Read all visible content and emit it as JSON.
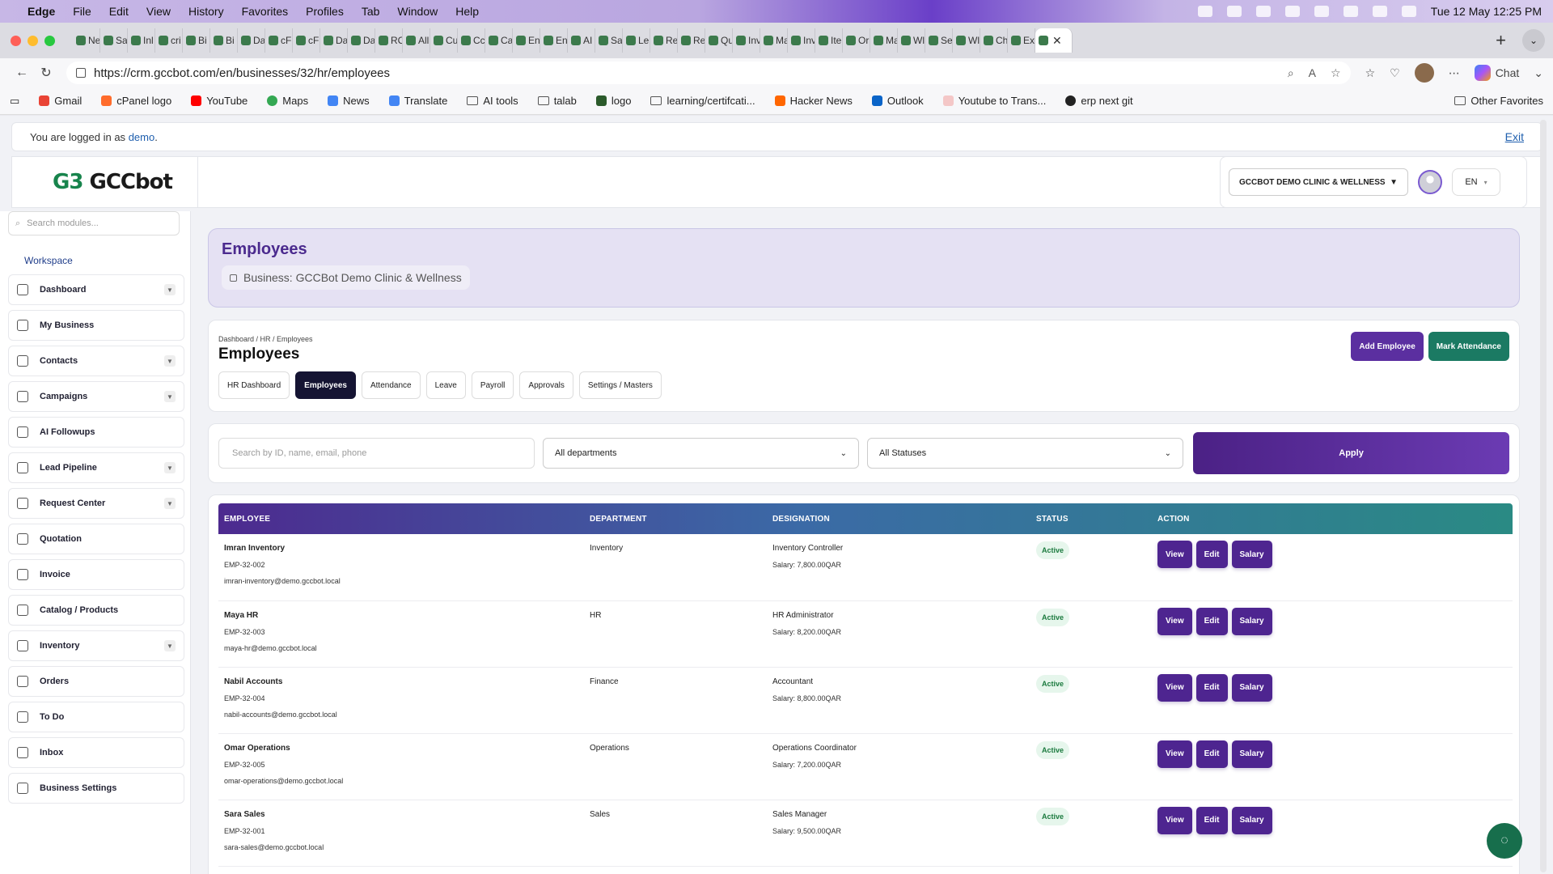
{
  "menubar": {
    "app": "Edge",
    "items": [
      "File",
      "Edit",
      "View",
      "History",
      "Favorites",
      "Profiles",
      "Tab",
      "Window",
      "Help"
    ],
    "clock": "Tue 12 May  12:25 PM"
  },
  "browser": {
    "tabs": [
      "Ne",
      "Sa",
      "Inl",
      "cri",
      "Bi",
      "Bi",
      "Da",
      "cF",
      "cF",
      "Da",
      "Da",
      "RC",
      "All",
      "Cu",
      "Cc",
      "Ca",
      "En",
      "En",
      "AI",
      "Sa",
      "Le",
      "Re",
      "Re",
      "Qu",
      "Inv",
      "Ma",
      "Inv",
      "Ite",
      "Or",
      "Ma",
      "Wl",
      "Se",
      "Wl",
      "Ch",
      "Ex"
    ],
    "url": "https://crm.gccbot.com/en/businesses/32/hr/employees",
    "chat_label": "Chat",
    "bookmarks": [
      "Gmail",
      "cPanel logo",
      "YouTube",
      "Maps",
      "News",
      "Translate",
      "AI tools",
      "talab",
      "logo",
      "learning/certifcati...",
      "Hacker News",
      "Outlook",
      "Youtube to Trans...",
      "erp next git"
    ],
    "other_favorites": "Other Favorites"
  },
  "login": {
    "prefix": "You are logged in as",
    "user": "demo",
    "suffix": ".",
    "exit": "Exit"
  },
  "header": {
    "logo_mark": "G3",
    "logo_text": "GCCbot",
    "business": "GCCBOT DEMO CLINIC & WELLNESS",
    "lang": "EN"
  },
  "sidebar": {
    "search_placeholder": "Search modules...",
    "workspace": "Workspace",
    "items": [
      {
        "label": "Dashboard",
        "caret": true
      },
      {
        "label": "My Business",
        "caret": false
      },
      {
        "label": "Contacts",
        "caret": true
      },
      {
        "label": "Campaigns",
        "caret": true
      },
      {
        "label": "AI Followups",
        "caret": false
      },
      {
        "label": "Lead Pipeline",
        "caret": true
      },
      {
        "label": "Request Center",
        "caret": true
      },
      {
        "label": "Quotation",
        "caret": false
      },
      {
        "label": "Invoice",
        "caret": false
      },
      {
        "label": "Catalog / Products",
        "caret": false
      },
      {
        "label": "Inventory",
        "caret": true
      },
      {
        "label": "Orders",
        "caret": false
      },
      {
        "label": "To Do",
        "caret": false
      },
      {
        "label": "Inbox",
        "caret": false
      },
      {
        "label": "Business Settings",
        "caret": false
      }
    ]
  },
  "hero": {
    "title": "Employees",
    "business_label": "Business: GCCBot Demo Clinic & Wellness"
  },
  "card": {
    "breadcrumb": "Dashboard / HR / Employees",
    "title": "Employees",
    "tabs": [
      "HR Dashboard",
      "Employees",
      "Attendance",
      "Leave",
      "Payroll",
      "Approvals",
      "Settings / Masters"
    ],
    "active_tab": "Employees",
    "add_employee": "Add Employee",
    "mark_attendance": "Mark Attendance"
  },
  "filters": {
    "search_placeholder": "Search by ID, name, email, phone",
    "department": "All departments",
    "status": "All Statuses",
    "apply": "Apply"
  },
  "table": {
    "headers": [
      "EMPLOYEE",
      "DEPARTMENT",
      "DESIGNATION",
      "STATUS",
      "ACTION"
    ],
    "rows": [
      {
        "name": "Imran Inventory",
        "id": "EMP-32-002",
        "email": "imran-inventory@demo.gccbot.local",
        "department": "Inventory",
        "designation": "Inventory Controller",
        "salary": "Salary: 7,800.00QAR",
        "status": "Active"
      },
      {
        "name": "Maya HR",
        "id": "EMP-32-003",
        "email": "maya-hr@demo.gccbot.local",
        "department": "HR",
        "designation": "HR Administrator",
        "salary": "Salary: 8,200.00QAR",
        "status": "Active"
      },
      {
        "name": "Nabil Accounts",
        "id": "EMP-32-004",
        "email": "nabil-accounts@demo.gccbot.local",
        "department": "Finance",
        "designation": "Accountant",
        "salary": "Salary: 8,800.00QAR",
        "status": "Active"
      },
      {
        "name": "Omar Operations",
        "id": "EMP-32-005",
        "email": "omar-operations@demo.gccbot.local",
        "department": "Operations",
        "designation": "Operations Coordinator",
        "salary": "Salary: 7,200.00QAR",
        "status": "Active"
      },
      {
        "name": "Sara Sales",
        "id": "EMP-32-001",
        "email": "sara-sales@demo.gccbot.local",
        "department": "Sales",
        "designation": "Sales Manager",
        "salary": "Salary: 9,500.00QAR",
        "status": "Active"
      }
    ],
    "actions": [
      "View",
      "Edit",
      "Salary"
    ]
  },
  "colors": {
    "brand_purple": "#5b2fa0",
    "brand_green": "#1b7a63",
    "active_badge": "#1b7a3e"
  }
}
